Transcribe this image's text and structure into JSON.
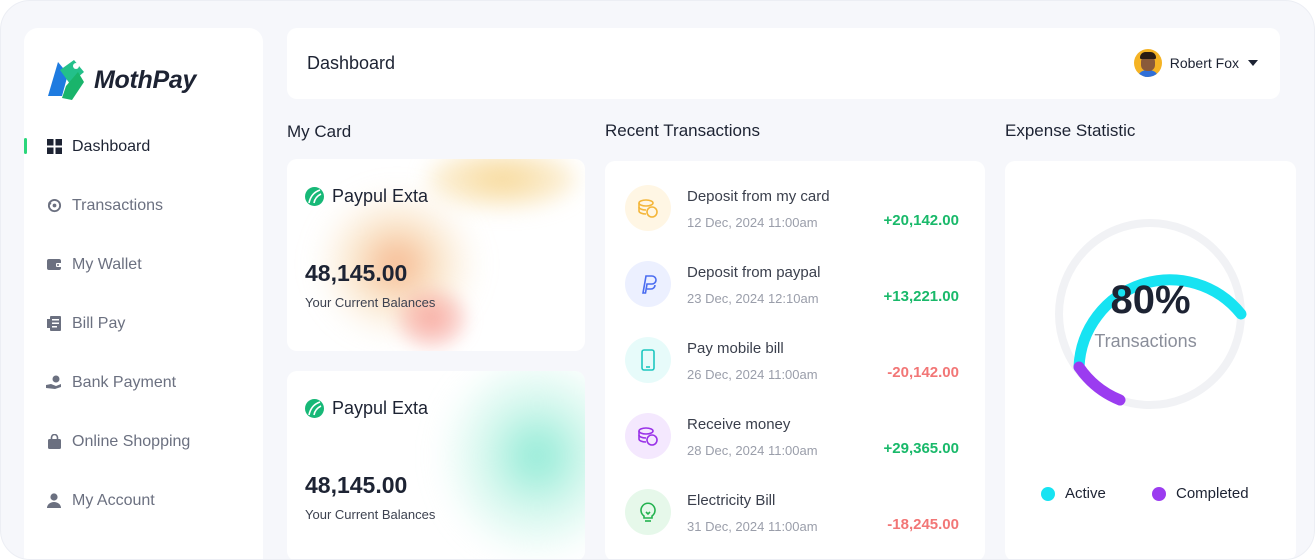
{
  "app": {
    "name": "MothPay"
  },
  "sidebar": {
    "items": [
      {
        "label": "Dashboard",
        "icon": "grid-icon",
        "active": true
      },
      {
        "label": "Transactions",
        "icon": "refresh-icon"
      },
      {
        "label": "My Wallet",
        "icon": "wallet-icon"
      },
      {
        "label": "Bill Pay",
        "icon": "receipt-icon"
      },
      {
        "label": "Bank Payment",
        "icon": "hand-coin-icon"
      },
      {
        "label": "Online Shopping",
        "icon": "bag-icon"
      },
      {
        "label": "My Account",
        "icon": "user-icon"
      }
    ]
  },
  "header": {
    "title": "Dashboard",
    "user_name": "Robert Fox"
  },
  "my_card": {
    "title": "My Card",
    "cards": [
      {
        "brand": "Paypul Exta",
        "amount": "48,145.00",
        "caption": "Your Current Balances"
      },
      {
        "brand": "Paypul Exta",
        "amount": "48,145.00",
        "caption": "Your Current Balances"
      }
    ]
  },
  "transactions": {
    "title": "Recent Transactions",
    "items": [
      {
        "title": "Deposit from my card",
        "date": "12 Dec, 2024 11:00am",
        "amount": "+20,142.00",
        "icon": "coins-icon",
        "color": "#f4b63a",
        "bg": "#fff6e4"
      },
      {
        "title": "Deposit from paypal",
        "date": "23 Dec, 2024 12:10am",
        "amount": "+13,221.00",
        "icon": "paypal-icon",
        "color": "#4a6cf0",
        "bg": "#ecf0ff"
      },
      {
        "title": "Pay mobile bill",
        "date": "26 Dec, 2024 11:00am",
        "amount": "-20,142.00",
        "icon": "mobile-icon",
        "color": "#1fc7c0",
        "bg": "#e7fbfa"
      },
      {
        "title": "Receive money",
        "date": "28 Dec, 2024 11:00am",
        "amount": "+29,365.00",
        "icon": "money-stack-icon",
        "color": "#9a33e8",
        "bg": "#f4e8fe"
      },
      {
        "title": "Electricity Bill",
        "date": "31 Dec, 2024 11:00am",
        "amount": "-18,245.00",
        "icon": "bulb-icon",
        "color": "#23b24f",
        "bg": "#e6f8ea"
      }
    ]
  },
  "expense": {
    "title": "Expense Statistic",
    "percent": "80%",
    "label": "Transactions",
    "legend": [
      {
        "label": "Active",
        "color": "#17e3f2"
      },
      {
        "label": "Completed",
        "color": "#9b3cf0"
      }
    ]
  }
}
